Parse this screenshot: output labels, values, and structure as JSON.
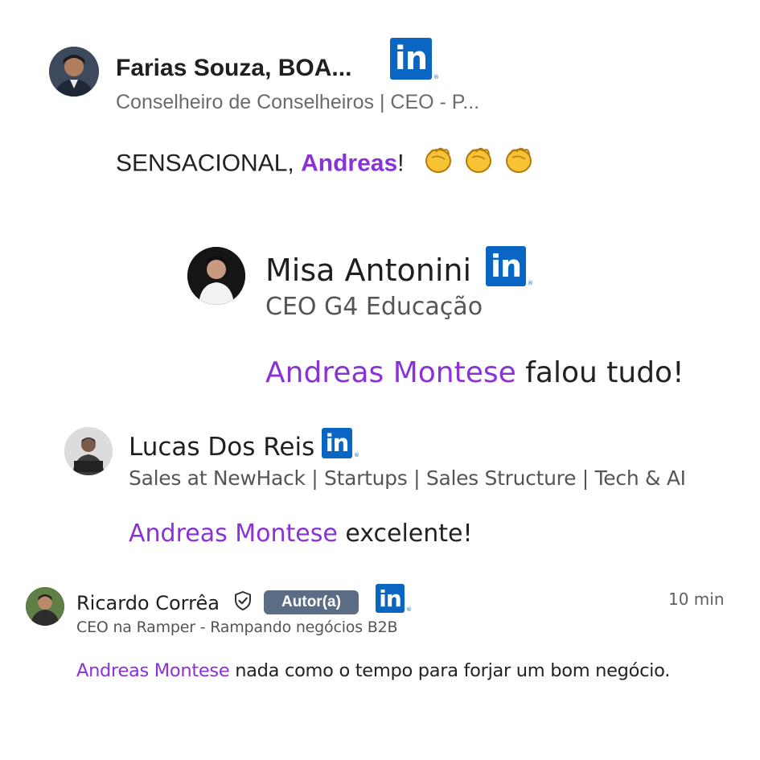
{
  "comments": [
    {
      "author": "Farias Souza, BOA...",
      "headline": "Conselheiro de Conselheiros | CEO - P...",
      "text_before": "SENSACIONAL, ",
      "mention": "Andreas",
      "text_after": "!",
      "reactions": [
        "clapping-hands",
        "clapping-hands",
        "clapping-hands"
      ]
    },
    {
      "author": "Misa Antonini",
      "headline": "CEO G4 Educação",
      "mention": "Andreas Montese",
      "text_after": " falou tudo!"
    },
    {
      "author": "Lucas Dos Reis",
      "headline": "Sales at NewHack | Startups | Sales Structure | Tech & AI",
      "mention": "Andreas Montese",
      "text_after": " excelente!"
    },
    {
      "author": "Ricardo Corrêa",
      "badge": "Autor(a)",
      "time": "10 min",
      "headline": "CEO na Ramper - Rampando negócios B2B",
      "mention": "Andreas Montese",
      "text_after": " nada como o tempo para forjar um bom negócio."
    }
  ],
  "linkedin": {
    "logo_text": "in",
    "registered": "®"
  },
  "colors": {
    "mention": "#8a32d6",
    "linkedin": "#0a66c2",
    "badge": "#5b6c85"
  }
}
